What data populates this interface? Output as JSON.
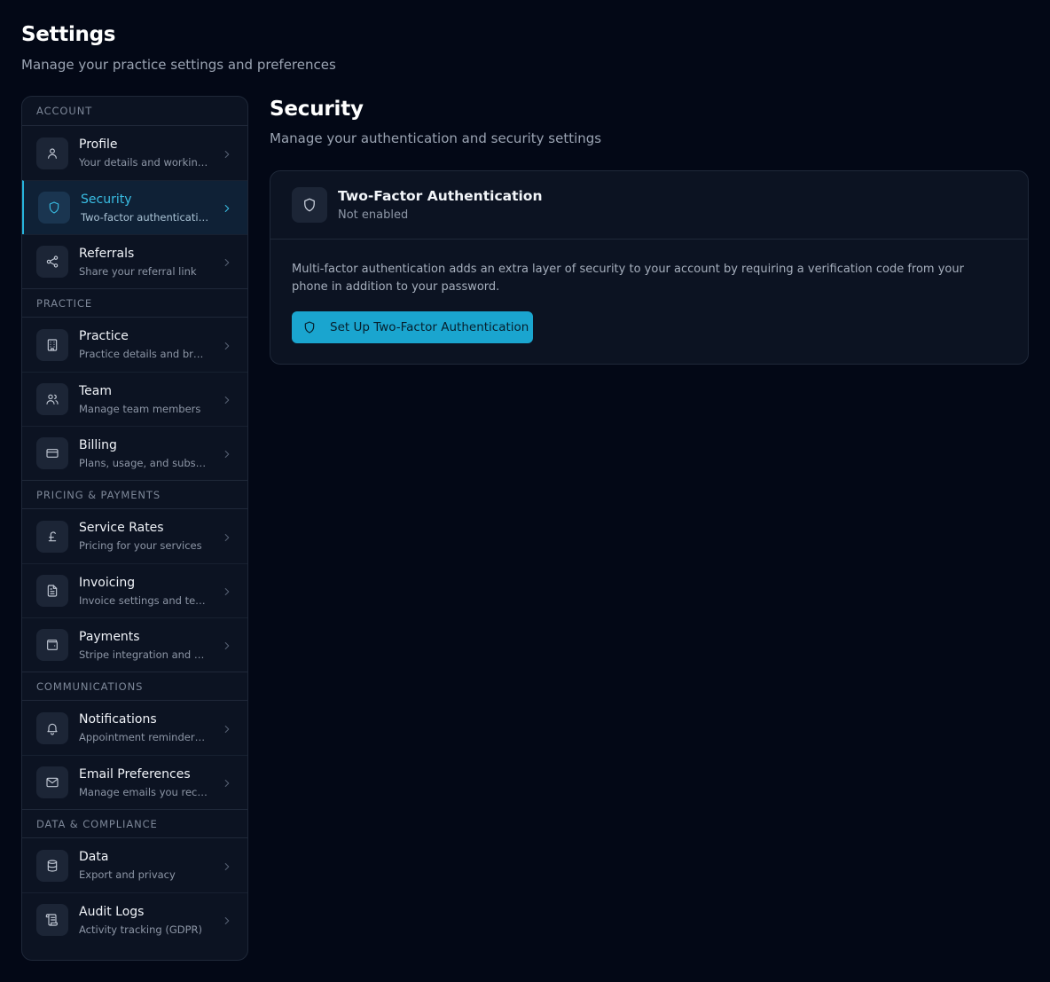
{
  "page": {
    "title": "Settings",
    "subtitle": "Manage your practice settings and preferences"
  },
  "sidebar": {
    "sections": [
      {
        "header": "ACCOUNT",
        "items": [
          {
            "label": "Profile",
            "desc": "Your details and working hours",
            "icon": "user-icon"
          },
          {
            "label": "Security",
            "desc": "Two-factor authentication",
            "icon": "shield-icon",
            "active": true
          },
          {
            "label": "Referrals",
            "desc": "Share your referral link",
            "icon": "share-icon"
          }
        ]
      },
      {
        "header": "PRACTICE",
        "items": [
          {
            "label": "Practice",
            "desc": "Practice details and branding",
            "icon": "building-icon"
          },
          {
            "label": "Team",
            "desc": "Manage team members",
            "icon": "users-icon"
          },
          {
            "label": "Billing",
            "desc": "Plans, usage, and subscriptions",
            "icon": "credit-card-icon"
          }
        ]
      },
      {
        "header": "PRICING & PAYMENTS",
        "items": [
          {
            "label": "Service Rates",
            "desc": "Pricing for your services",
            "icon": "pound-icon"
          },
          {
            "label": "Invoicing",
            "desc": "Invoice settings and templates",
            "icon": "file-text-icon"
          },
          {
            "label": "Payments",
            "desc": "Stripe integration and card payments",
            "icon": "wallet-icon"
          }
        ]
      },
      {
        "header": "COMMUNICATIONS",
        "items": [
          {
            "label": "Notifications",
            "desc": "Appointment reminders and alerts",
            "icon": "bell-icon"
          },
          {
            "label": "Email Preferences",
            "desc": "Manage emails you receive",
            "icon": "mail-icon"
          }
        ]
      },
      {
        "header": "DATA & COMPLIANCE",
        "items": [
          {
            "label": "Data",
            "desc": "Export and privacy",
            "icon": "database-icon"
          },
          {
            "label": "Audit Logs",
            "desc": "Activity tracking (GDPR)",
            "icon": "scroll-icon"
          }
        ]
      }
    ]
  },
  "main": {
    "title": "Security",
    "subtitle": "Manage your authentication and security settings",
    "card": {
      "title": "Two-Factor Authentication",
      "status": "Not enabled",
      "description": "Multi-factor authentication adds an extra layer of security to your account by requiring a verification code from your phone in addition to your password.",
      "button_label": "Set Up Two-Factor Authentication"
    }
  },
  "colors": {
    "background": "#030816",
    "panel": "#0c1322",
    "accent": "#1aa5cf",
    "accent_text": "#39bde3"
  }
}
